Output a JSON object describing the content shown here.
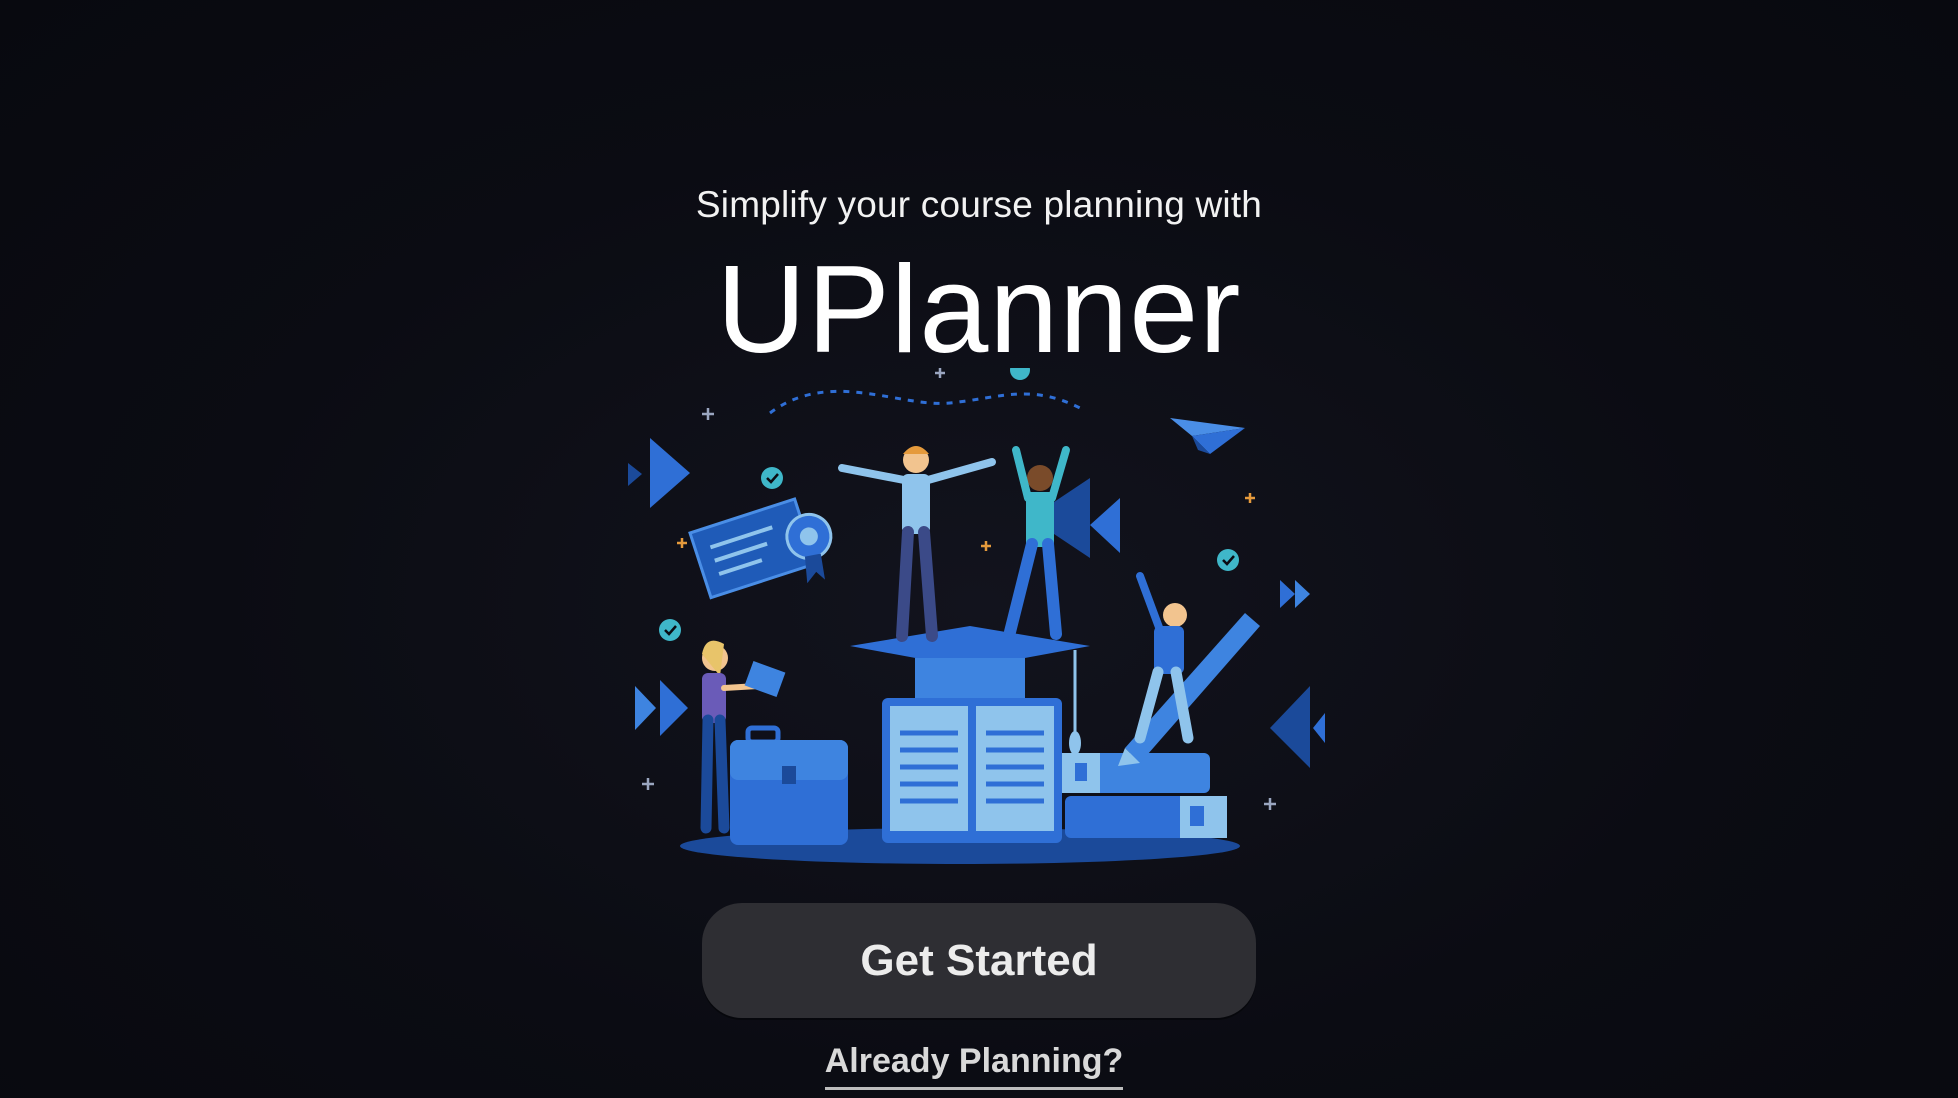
{
  "welcome": {
    "tagline": "Simplify your course planning with",
    "brand": "UPlanner",
    "primary_button_label": "Get Started",
    "secondary_link_label": "Already Planning?"
  },
  "theme": {
    "background": "#0b0c13",
    "button_background": "#2e2e33",
    "illustration_primary": "#2f6fd6",
    "illustration_dark": "#1b4a9a",
    "illustration_light": "#8fc4ec",
    "accent_teal": "#3fb7c9",
    "accent_orange": "#e59a3c"
  },
  "illustration": {
    "subject": "students-celebrating-education-illustration",
    "icons": [
      "graduation-cap-icon",
      "open-book-icon",
      "briefcase-icon",
      "paper-plane-icon",
      "certificate-icon",
      "pencil-icon",
      "stacked-books-icon",
      "checkmark-badge-icon"
    ]
  }
}
